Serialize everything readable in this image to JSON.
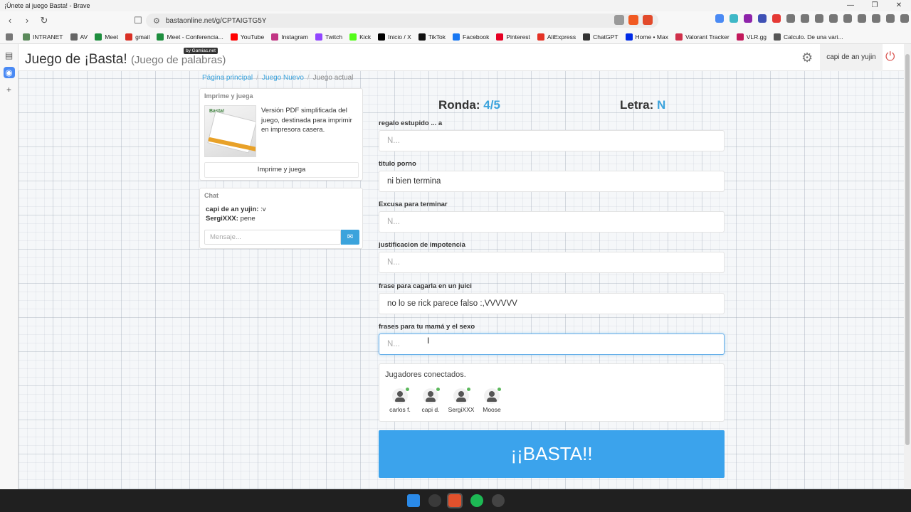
{
  "window": {
    "title": "¡Únete al juego Basta! - Brave"
  },
  "browser": {
    "url": "bastaonline.net/g/CPTAIGTG5Y",
    "bookmarks": [
      {
        "label": "INTRANET",
        "icon": "globe-icon",
        "color": "#5b8a5b"
      },
      {
        "label": "AV",
        "icon": "globe-icon",
        "color": "#666666"
      },
      {
        "label": "Meet",
        "icon": "meet-icon",
        "color": "#1e8e3e"
      },
      {
        "label": "gmail",
        "icon": "gmail-icon",
        "color": "#d93025"
      },
      {
        "label": "Meet - Conferencia...",
        "icon": "meet-icon",
        "color": "#1e8e3e"
      },
      {
        "label": "YouTube",
        "icon": "youtube-icon",
        "color": "#ff0000"
      },
      {
        "label": "Instagram",
        "icon": "instagram-icon",
        "color": "#c13584"
      },
      {
        "label": "Twitch",
        "icon": "twitch-icon",
        "color": "#9146ff"
      },
      {
        "label": "Kick",
        "icon": "kick-icon",
        "color": "#53fc18"
      },
      {
        "label": "Inicio / X",
        "icon": "x-icon",
        "color": "#000000"
      },
      {
        "label": "TikTok",
        "icon": "tiktok-icon",
        "color": "#111111"
      },
      {
        "label": "Facebook",
        "icon": "facebook-icon",
        "color": "#1877f2"
      },
      {
        "label": "Pinterest",
        "icon": "pinterest-icon",
        "color": "#e60023"
      },
      {
        "label": "AliExpress",
        "icon": "aliexpress-icon",
        "color": "#e43225"
      },
      {
        "label": "ChatGPT",
        "icon": "chatgpt-icon",
        "color": "#333333"
      },
      {
        "label": "Home • Max",
        "icon": "max-icon",
        "color": "#002be7"
      },
      {
        "label": "Valorant Tracker",
        "icon": "tracker-icon",
        "color": "#d0304a"
      },
      {
        "label": "VLR.gg",
        "icon": "vlr-icon",
        "color": "#c2185b"
      },
      {
        "label": "Calculo. De una vari...",
        "icon": "globe-icon",
        "color": "#555555"
      }
    ]
  },
  "header": {
    "title": "Juego de ¡Basta!",
    "subtitle": "(Juego de palabras)",
    "badge": "by Gamiac.net",
    "user": "capi de an yujin"
  },
  "breadcrumb": [
    "Página principal",
    "Juego Nuevo",
    "Juego actual"
  ],
  "print_panel": {
    "title": "Imprime y juega",
    "description": "Versión PDF simplificada del juego, destinada para imprimir en impresora casera.",
    "button": "Imprime y juega",
    "image_text": "Basta!"
  },
  "chat": {
    "title": "Chat",
    "messages": [
      {
        "user": "capi de an yujin:",
        "text": " :v"
      },
      {
        "user": "SergiXXX:",
        "text": " pene"
      }
    ],
    "placeholder": "Mensaje..."
  },
  "game": {
    "round_label": "Ronda:",
    "round_value": "4/5",
    "letter_label": "Letra:",
    "letter_value": "N",
    "fields": [
      {
        "label": "regalo estupido ... a",
        "value": "N..."
      },
      {
        "label": "titulo porno",
        "value": "ni bien termina"
      },
      {
        "label": "Excusa para terminar",
        "value": "N..."
      },
      {
        "label": "justificacion de impotencia",
        "value": "N..."
      },
      {
        "label": "frase para cagarla en un juici",
        "value": "no lo se rick parece falso :,VVVVVV"
      },
      {
        "label": "frases para tu mamá y el sexo",
        "value": "N..."
      }
    ]
  },
  "players": {
    "title": "Jugadores conectados.",
    "list": [
      "carlos f.",
      "capi d.",
      "SergiXXX",
      "Moose"
    ]
  },
  "basta_button": "¡¡BASTA!!",
  "colors": {
    "accent": "#3ba3dc",
    "button": "#3ba3ec",
    "online": "#5cb85c"
  }
}
